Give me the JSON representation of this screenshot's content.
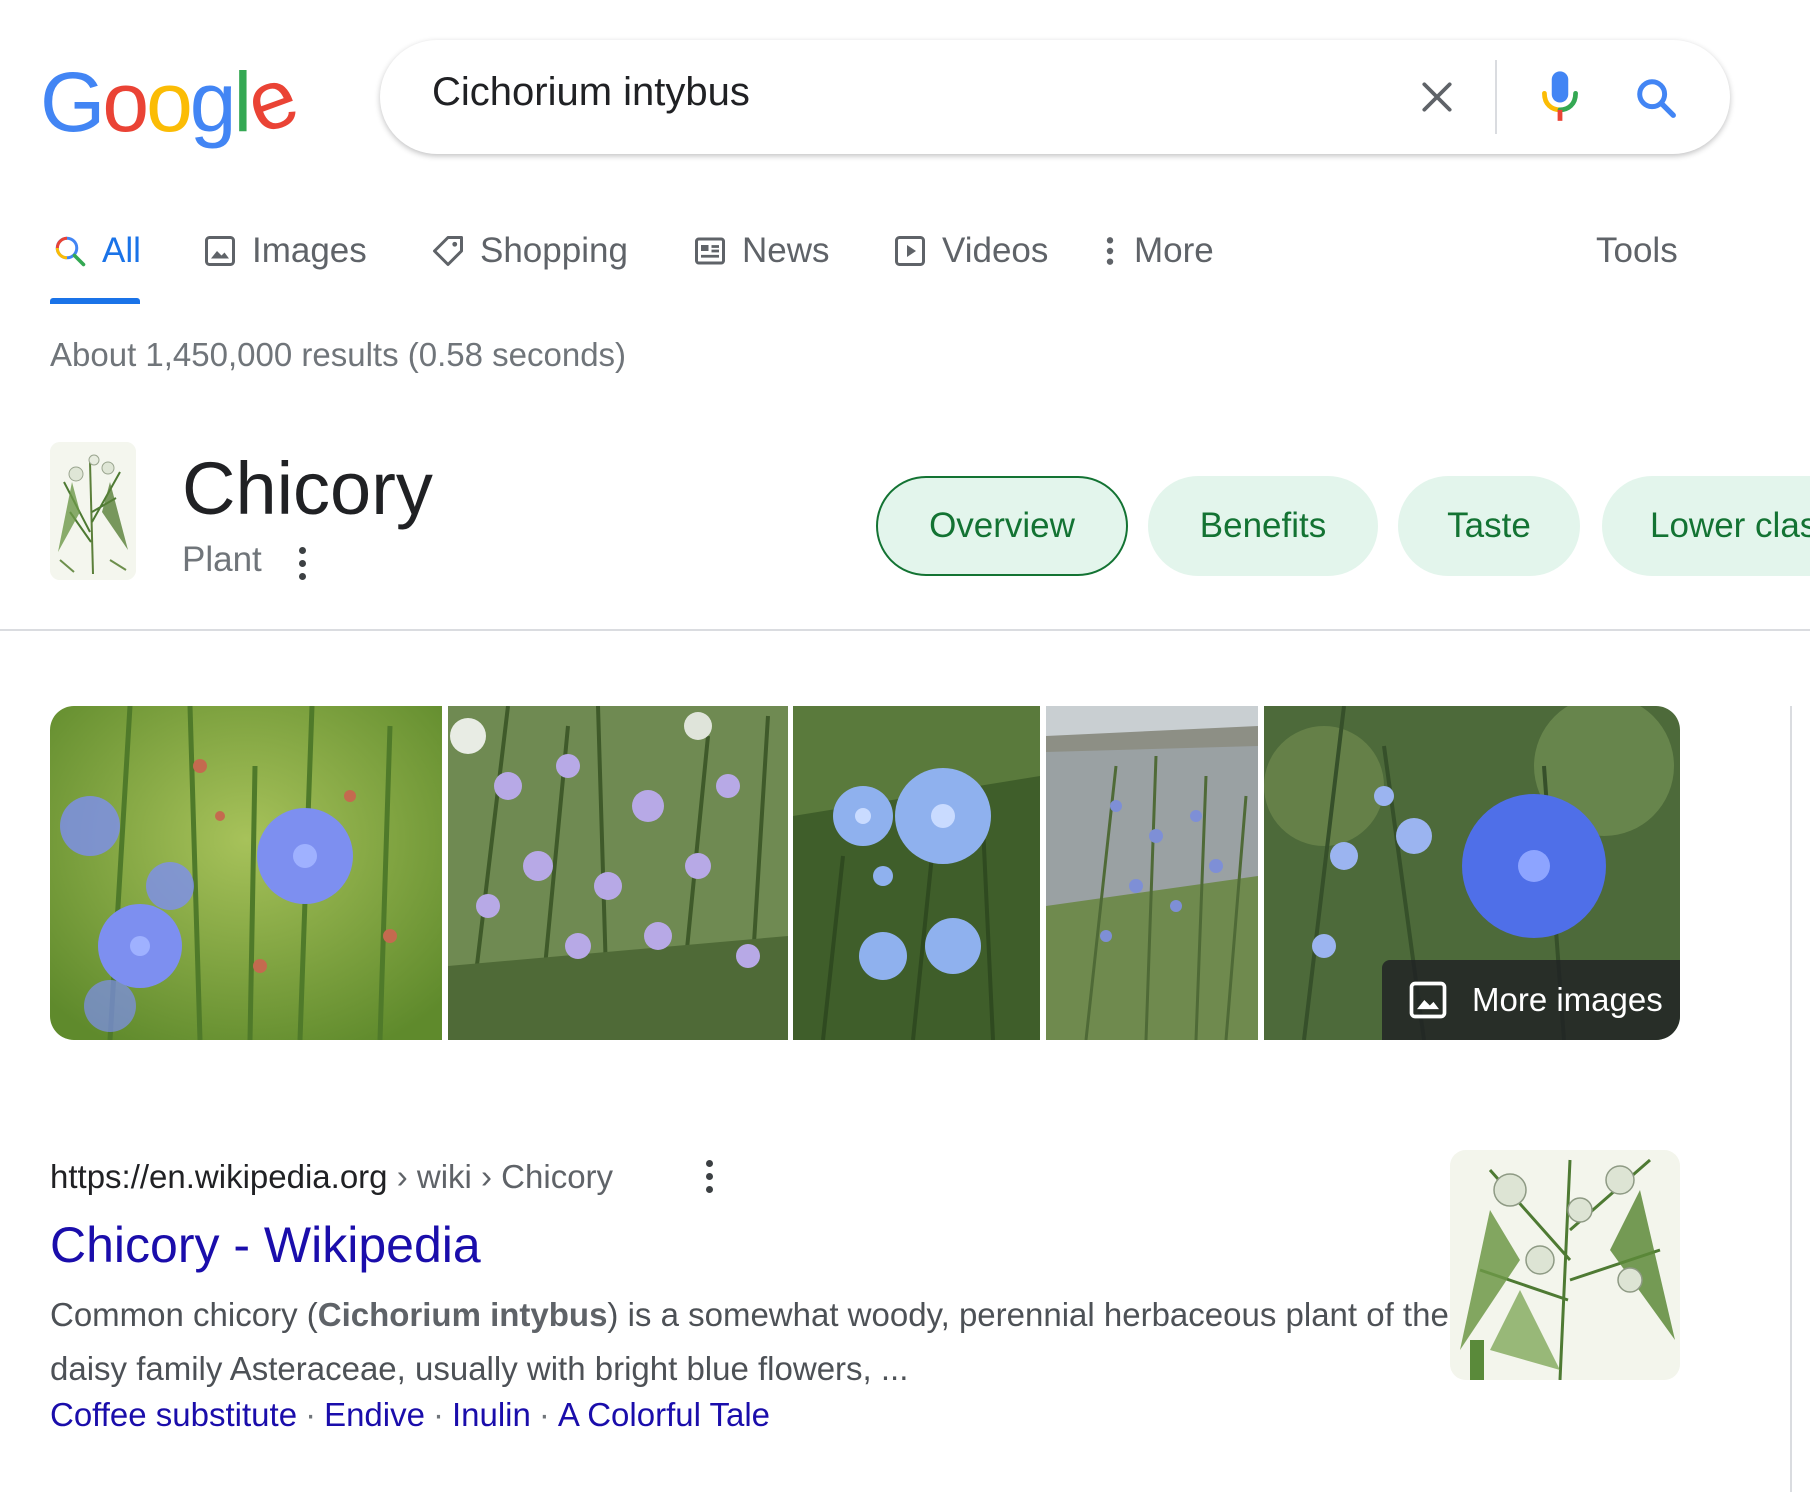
{
  "colors": {
    "accent": "#1a73e8",
    "link": "#1a0dab",
    "chip_bg": "#e3f5ec",
    "chip_text": "#137333",
    "logo_blue": "#4285f4",
    "logo_red": "#ea4335",
    "logo_yellow": "#fbbc05",
    "logo_green": "#34a853"
  },
  "logo": {
    "letters": [
      "G",
      "o",
      "o",
      "g",
      "l",
      "e"
    ]
  },
  "search": {
    "query": "Cichorium intybus"
  },
  "tabs": [
    {
      "label": "All",
      "icon": "search-icon",
      "active": true
    },
    {
      "label": "Images",
      "icon": "image-icon"
    },
    {
      "label": "Shopping",
      "icon": "tag-icon"
    },
    {
      "label": "News",
      "icon": "newspaper-icon"
    },
    {
      "label": "Videos",
      "icon": "play-icon"
    },
    {
      "label": "More",
      "icon": "more-vert-icon"
    }
  ],
  "tools_label": "Tools",
  "stats": "About 1,450,000 results (0.58 seconds)",
  "knowledge_panel": {
    "title": "Chicory",
    "subtitle": "Plant",
    "chips": [
      "Overview",
      "Benefits",
      "Taste",
      "Lower clas"
    ],
    "selected_chip": "Overview"
  },
  "gallery": {
    "image_count": 5,
    "more_images_label": "More images"
  },
  "result": {
    "url_domain": "https://en.wikipedia.org",
    "breadcrumb": " › wiki › Chicory",
    "title": "Chicory - Wikipedia",
    "snippet_before": "Common chicory (",
    "snippet_bold": "Cichorium intybus",
    "snippet_after": ") is a somewhat woody, perennial herbaceous plant of the daisy family Asteraceae, usually with bright blue flowers, ...",
    "sitelinks": [
      "Coffee substitute",
      "Endive",
      "Inulin",
      "A Colorful Tale"
    ],
    "sitelink_separator": "·"
  }
}
